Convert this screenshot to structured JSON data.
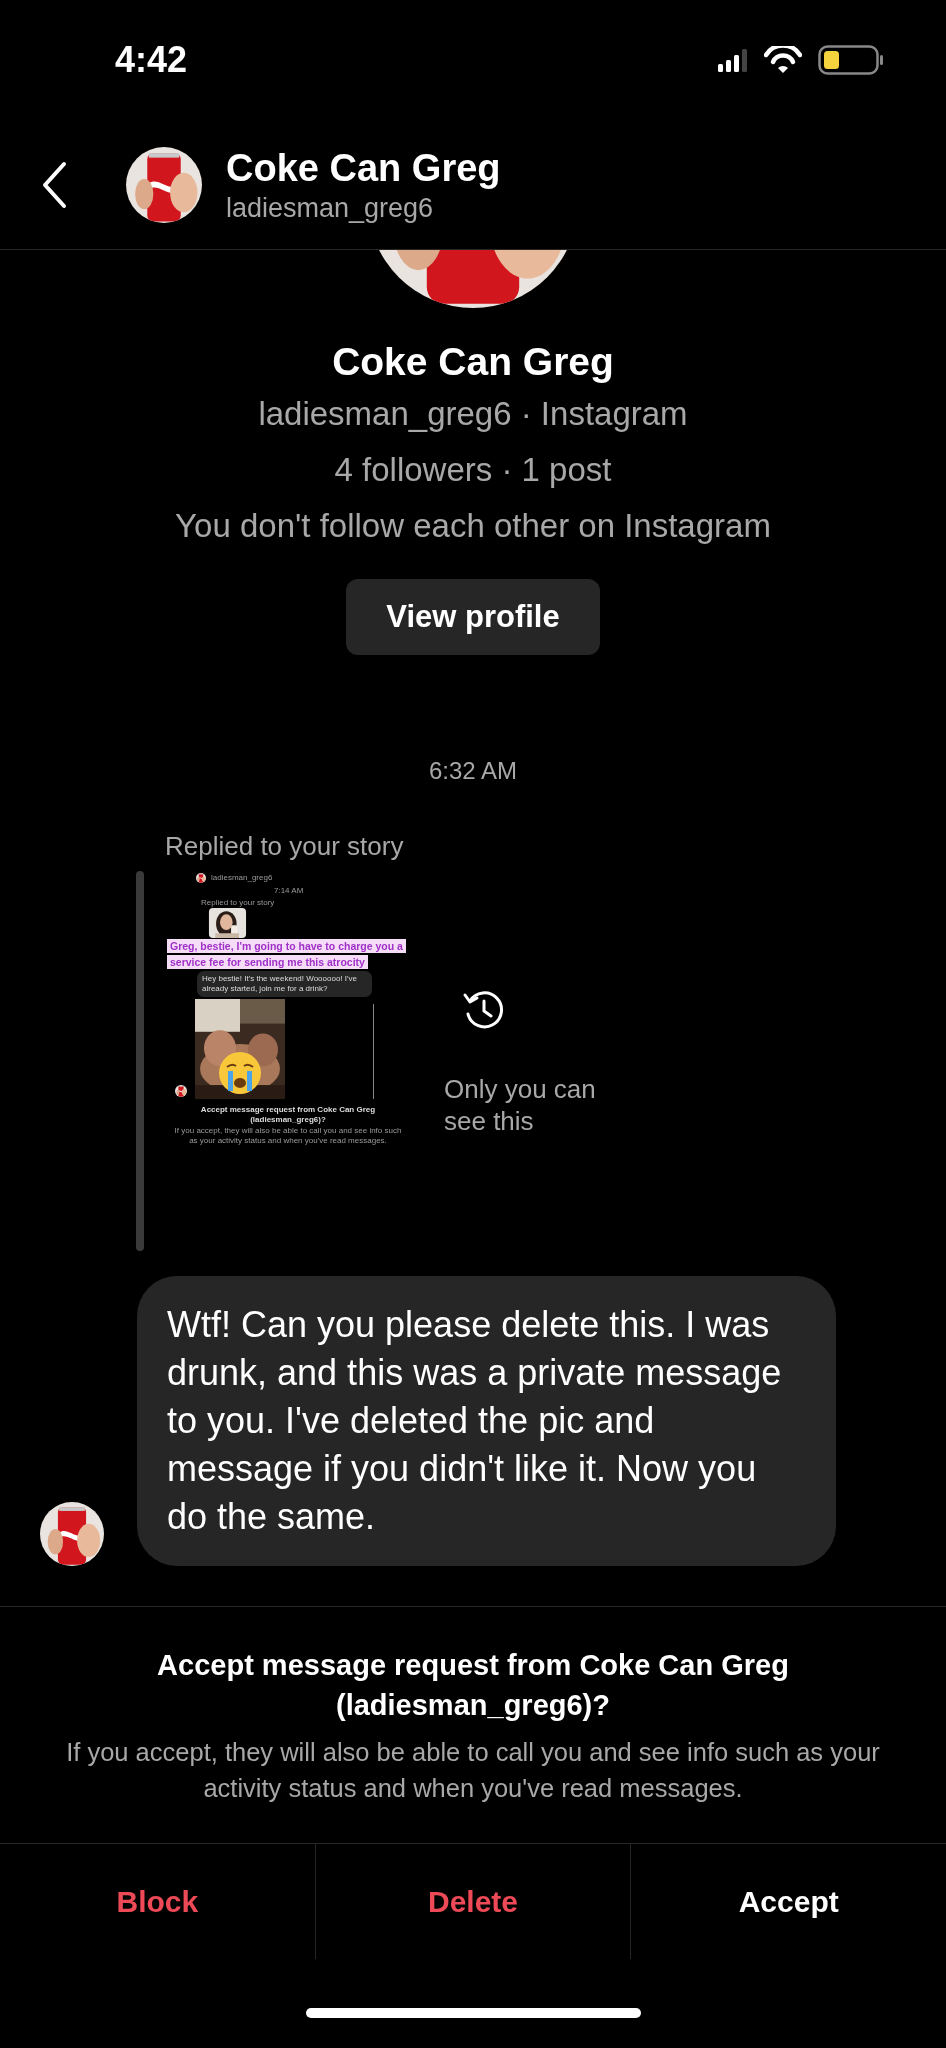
{
  "status_bar": {
    "time": "4:42"
  },
  "header": {
    "name": "Coke Can Greg",
    "username": "ladiesman_greg6"
  },
  "profile": {
    "name": "Coke Can Greg",
    "subtitle": "ladiesman_greg6 · Instagram",
    "stats": "4 followers · 1 post",
    "relationship": "You don't follow each other on Instagram",
    "button": "View profile"
  },
  "messages": [
    {
      "kind": "timestamp",
      "text": "6:32 AM"
    },
    {
      "kind": "story_reply",
      "label": "Replied to your story",
      "note": "Only you can see this",
      "screenshot": {
        "username": "ladiesman_greg6",
        "time": "7:14 AM",
        "label": "Replied to your story",
        "caption": "Greg, bestie, I'm going to have to charge you a service fee for sending me this atrocity",
        "message": "Hey bestie! It's the weekend! Woooooo! I've already started, join me for a drink?",
        "request_title": "Accept message request from Coke Can Greg (ladiesman_greg6)?",
        "request_description": "If you accept, they will also be able to call you and see info such as your activity status and when you've read messages."
      }
    },
    {
      "kind": "text",
      "text": "Wtf! Can you please delete this. I was drunk, and this was a private message to you. I've deleted the pic and message if you didn't like it. Now you do the same."
    }
  ],
  "request": {
    "title": "Accept message request from Coke Can Greg (ladiesman_greg6)?",
    "description": "If you accept, they will also be able to call you and see info such as your activity status and when you've read messages."
  },
  "actions": [
    {
      "label": "Block",
      "kind": "destructive"
    },
    {
      "label": "Delete",
      "kind": "destructive"
    },
    {
      "label": "Accept",
      "kind": "primary"
    }
  ]
}
